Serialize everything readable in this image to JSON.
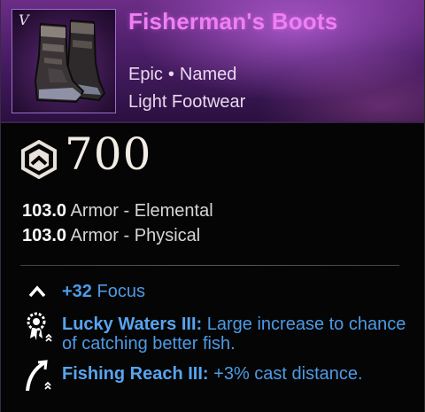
{
  "item": {
    "name": "Fisherman's Boots",
    "tier": "V",
    "rarity": "Epic",
    "separator": "•",
    "named_label": "Named",
    "category": "Light Footwear",
    "image_icon": "leather-boots-icon"
  },
  "gear_score": {
    "icon": "gear-score-hexagon-icon",
    "value": "700"
  },
  "stats": [
    {
      "value": "103.0",
      "label": "Armor - Elemental"
    },
    {
      "value": "103.0",
      "label": "Armor - Physical"
    }
  ],
  "attribute": {
    "icon": "chevron-up-icon",
    "value": "+32",
    "label": "Focus"
  },
  "perks": [
    {
      "icon": "lucky-waters-perk-icon",
      "name": "Lucky Waters III:",
      "description": "Large increase to chance of catching better fish."
    },
    {
      "icon": "fishing-reach-perk-icon",
      "name": "Fishing Reach III:",
      "description": "+3% cast distance."
    }
  ],
  "colors": {
    "title": "#f07ef4",
    "rarity_header": "#6b2d86",
    "perk_text": "#4d9be6",
    "background": "#050505"
  }
}
